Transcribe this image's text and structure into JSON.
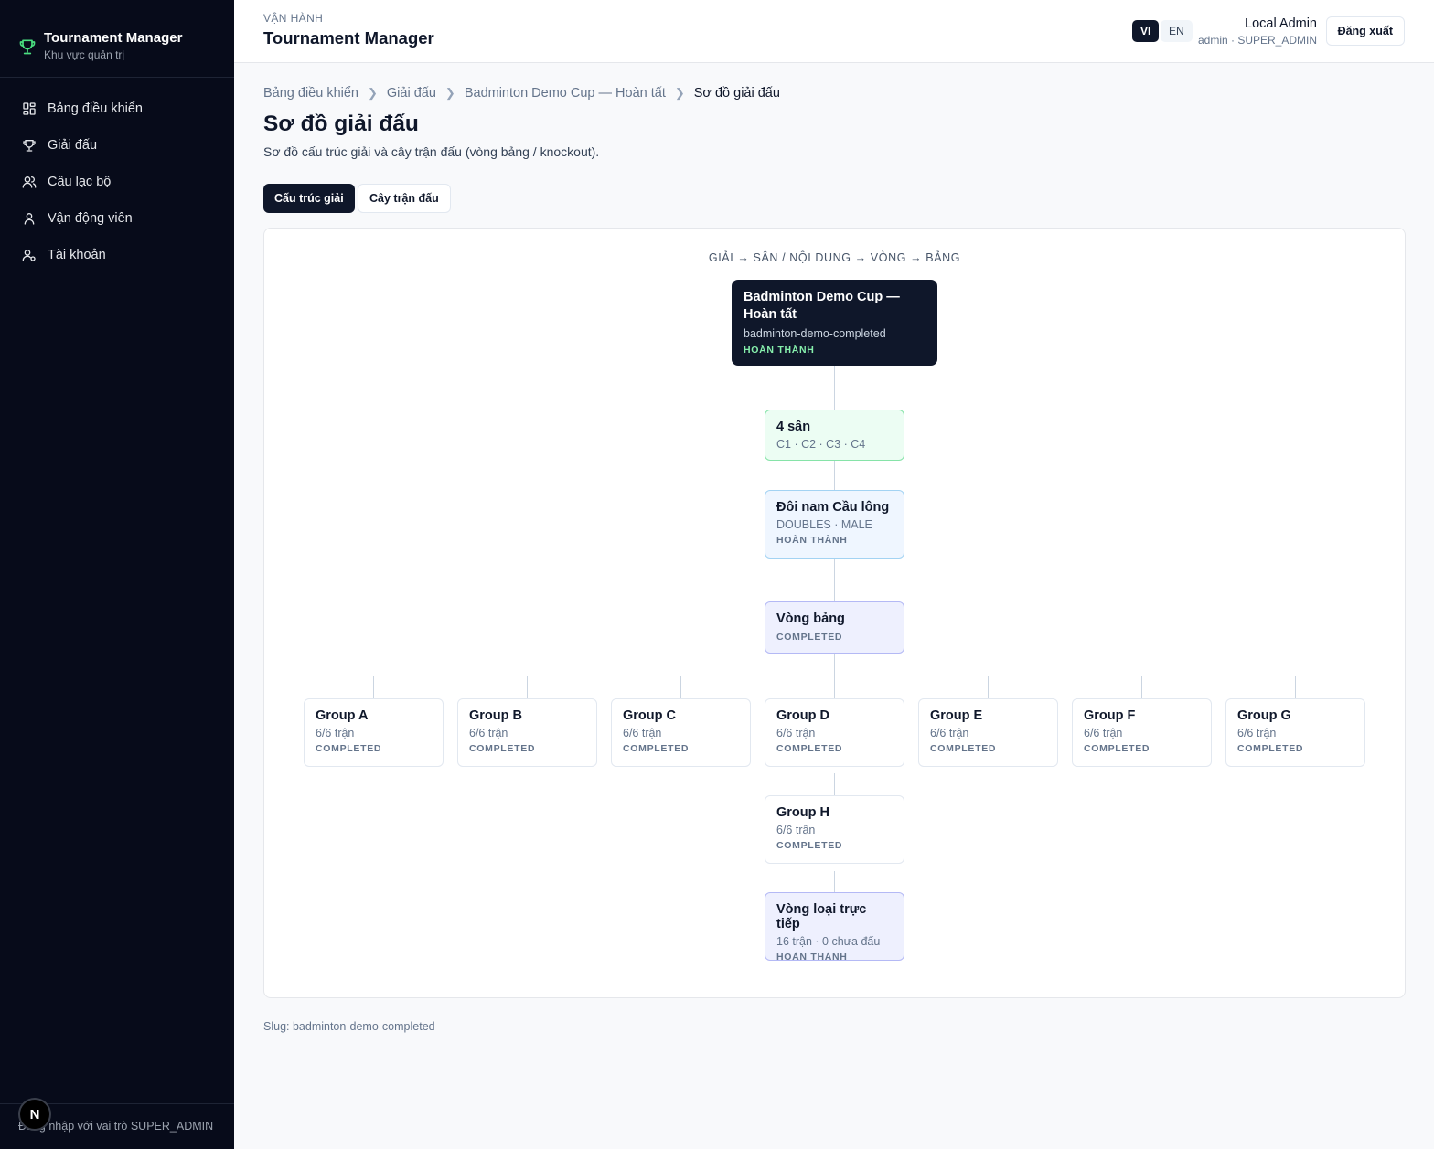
{
  "sidebar": {
    "brand_title": "Tournament Manager",
    "brand_sub": "Khu vực quản trị",
    "items": [
      {
        "label": "Bảng điều khiển",
        "icon": "dashboard-icon"
      },
      {
        "label": "Giải đấu",
        "icon": "trophy-icon"
      },
      {
        "label": "Câu lạc bộ",
        "icon": "users-icon"
      },
      {
        "label": "Vận động viên",
        "icon": "user-icon"
      },
      {
        "label": "Tài khoản",
        "icon": "account-icon"
      }
    ],
    "footer_text": "Đăng nhập với vai trò SUPER_ADMIN",
    "badge": "N"
  },
  "header": {
    "kicker": "VẬN HÀNH",
    "title": "Tournament Manager",
    "lang_vi": "VI",
    "lang_en": "EN",
    "user_name": "Local Admin",
    "user_role": "admin · SUPER_ADMIN",
    "logout_label": "Đăng xuất"
  },
  "breadcrumb": [
    "Bảng điều khiển",
    "Giải đấu",
    "Badminton Demo Cup — Hoàn tất",
    "Sơ đồ giải đấu"
  ],
  "page": {
    "title": "Sơ đồ giải đấu",
    "description": "Sơ đồ cấu trúc giải và cây trận đấu (vòng bảng / knockout).",
    "tabs": [
      "Cấu trúc giải",
      "Cây trận đấu"
    ],
    "slug": "Slug: badminton-demo-completed"
  },
  "diagram": {
    "caption": "GIẢI → SÂN / NỘI DUNG → VÒNG → BẢNG",
    "root": {
      "title": "Badminton Demo Cup — Hoàn tất",
      "slug": "badminton-demo-completed",
      "status": "HOÀN THÀNH"
    },
    "courts": {
      "title": "4 sân",
      "sub": "C1 · C2 · C3 · C4"
    },
    "event": {
      "title": "Đôi nam Cầu lông",
      "sub": "DOUBLES · MALE",
      "status": "HOÀN THÀNH"
    },
    "stage": {
      "title": "Vòng bảng",
      "status": "COMPLETED"
    },
    "groups": [
      {
        "title": "Group A",
        "sub": "6/6 trận",
        "status": "COMPLETED"
      },
      {
        "title": "Group B",
        "sub": "6/6 trận",
        "status": "COMPLETED"
      },
      {
        "title": "Group C",
        "sub": "6/6 trận",
        "status": "COMPLETED"
      },
      {
        "title": "Group D",
        "sub": "6/6 trận",
        "status": "COMPLETED"
      },
      {
        "title": "Group E",
        "sub": "6/6 trận",
        "status": "COMPLETED"
      },
      {
        "title": "Group F",
        "sub": "6/6 trận",
        "status": "COMPLETED"
      },
      {
        "title": "Group G",
        "sub": "6/6 trận",
        "status": "COMPLETED"
      },
      {
        "title": "Group H",
        "sub": "6/6 trận",
        "status": "COMPLETED"
      }
    ],
    "knockout": {
      "title": "Vòng loại trực tiếp",
      "sub": "16 trận · 0 chưa đấu",
      "status": "HOÀN THÀNH"
    }
  },
  "colors": {
    "sidebar_bg": "#070b1a",
    "accent_dark": "#0f172a",
    "success_green": "#86efac",
    "brand_icon": "#4ade80"
  }
}
